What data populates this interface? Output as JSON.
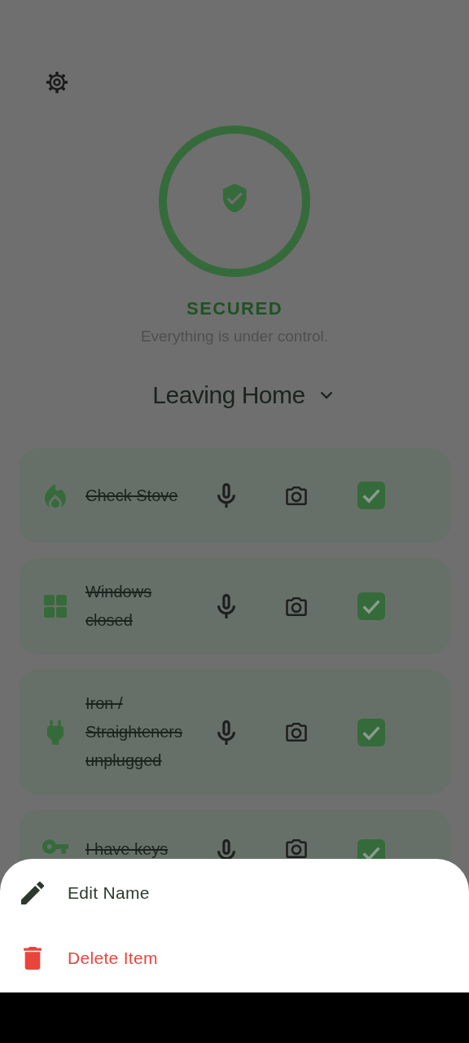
{
  "status": {
    "label": "SECURED",
    "message": "Everything is under control."
  },
  "routine": {
    "title": "Leaving Home"
  },
  "items": [
    {
      "kind": "flame",
      "label": "Check Stove",
      "checked": true
    },
    {
      "kind": "window",
      "label": "Windows closed",
      "checked": true
    },
    {
      "kind": "plug",
      "label": "Iron / Straighteners unplugged",
      "checked": true
    },
    {
      "kind": "key",
      "label": "I have keys",
      "checked": true
    }
  ],
  "sheet": [
    {
      "kind": "edit",
      "label": "Edit Name"
    },
    {
      "kind": "delete",
      "label": "Delete Item"
    }
  ]
}
